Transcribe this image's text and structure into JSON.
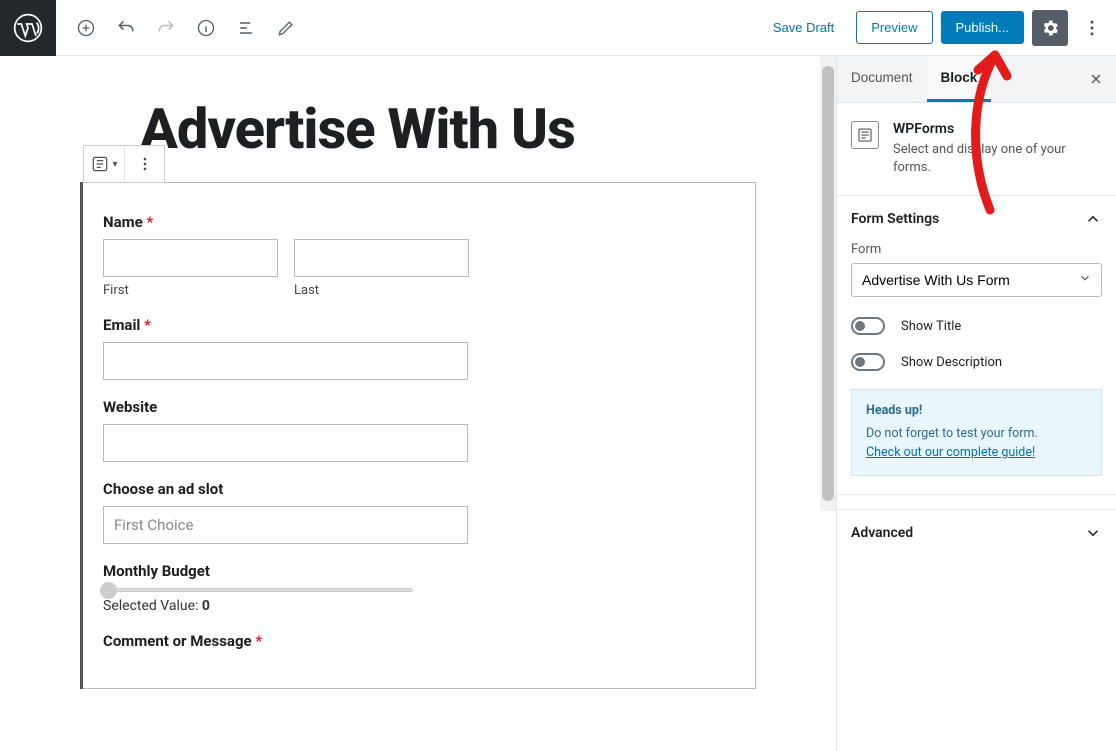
{
  "toolbar": {
    "save_draft": "Save Draft",
    "preview": "Preview",
    "publish": "Publish..."
  },
  "editor": {
    "title": "Advertise With Us",
    "form": {
      "name_label": "Name",
      "first_sub": "First",
      "last_sub": "Last",
      "email_label": "Email",
      "website_label": "Website",
      "adslot_label": "Choose an ad slot",
      "adslot_placeholder": "First Choice",
      "budget_label": "Monthly Budget",
      "budget_value_label": "Selected Value:",
      "budget_value": "0",
      "comment_label": "Comment or Message"
    }
  },
  "sidebar": {
    "tab_document": "Document",
    "tab_block": "Block",
    "block": {
      "title": "WPForms",
      "desc": "Select and display one of your forms."
    },
    "form_settings": {
      "header": "Form Settings",
      "form_label": "Form",
      "form_selected": "Advertise With Us Form",
      "show_title": "Show Title",
      "show_desc": "Show Description"
    },
    "headsup": {
      "title": "Heads up!",
      "line1": "Do not forget to test your form.",
      "link": "Check out our complete guide!"
    },
    "advanced": "Advanced"
  }
}
